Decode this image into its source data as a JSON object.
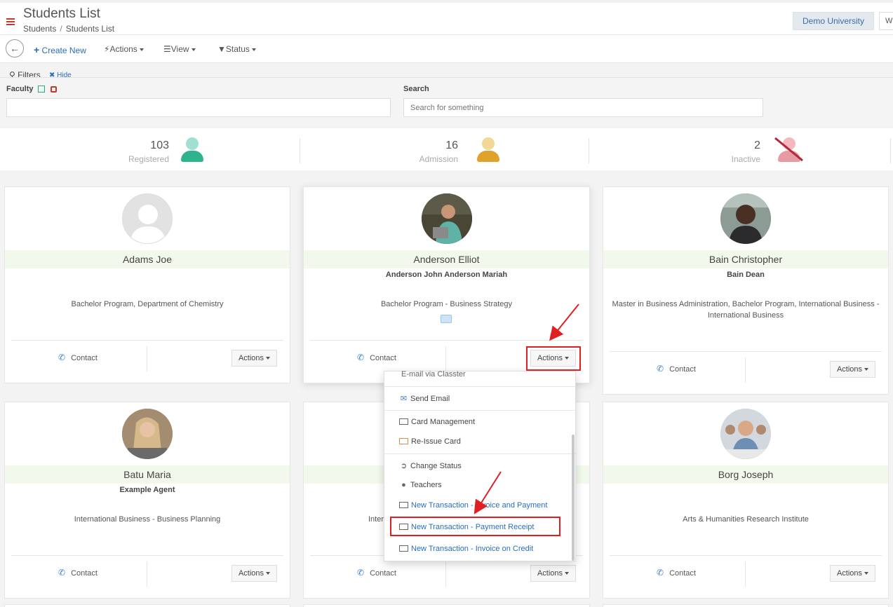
{
  "header": {
    "title": "Students List",
    "breadcrumb": [
      "Students",
      "Students List"
    ],
    "tenant": "Demo University",
    "extra": "Wi"
  },
  "toolbar": {
    "create": "Create New",
    "actions": "Actions",
    "view": "View",
    "status": "Status"
  },
  "filters": {
    "title": "Filters",
    "hide": "Hide",
    "faculty_label": "Faculty",
    "search_label": "Search",
    "search_placeholder": "Search for something"
  },
  "stats": [
    {
      "count": "103",
      "label": "Registered",
      "color": "#2fb38f",
      "head": "#9fe0d2"
    },
    {
      "count": "16",
      "label": "Admission",
      "color": "#e0a22a",
      "head": "#f2d796"
    },
    {
      "count": "2",
      "label": "Inactive",
      "color": "#e89aa2",
      "head": "#f4b8be"
    }
  ],
  "cards": [
    {
      "name": "Adams Joe",
      "sub": "",
      "program": "Bachelor Program, Department of Chemistry",
      "contact": "Contact",
      "actions": "Actions"
    },
    {
      "name": "Anderson Elliot",
      "sub": "Anderson John Anderson Mariah",
      "program": "Bachelor Program  -  Business Strategy",
      "contact": "Contact",
      "actions": "Actions"
    },
    {
      "name": "Bain Christopher",
      "sub": "Bain Dean",
      "program": "Master in Business Administration, Bachelor Program, International Business  -  International Business",
      "contact": "Contact",
      "actions": "Actions"
    },
    {
      "name": "Batu Maria",
      "sub": "Example Agent",
      "program": "International Business  -  Business Planning",
      "contact": "Contact",
      "actions": "Actions"
    },
    {
      "name": "",
      "sub": "",
      "program": "Inter",
      "contact": "Contact",
      "actions": "Actions"
    },
    {
      "name": "Borg Joseph",
      "sub": "",
      "program": "Arts & Humanities Research Institute",
      "contact": "Contact",
      "actions": "Actions"
    }
  ],
  "dropdown": [
    "E-mail via Classter",
    "Send Email",
    "Card Management",
    "Re-Issue Card",
    "Change Status",
    "Teachers",
    "New Transaction - Invoice and Payment",
    "New Transaction - Payment Receipt",
    "New Transaction - Invoice on Credit"
  ]
}
